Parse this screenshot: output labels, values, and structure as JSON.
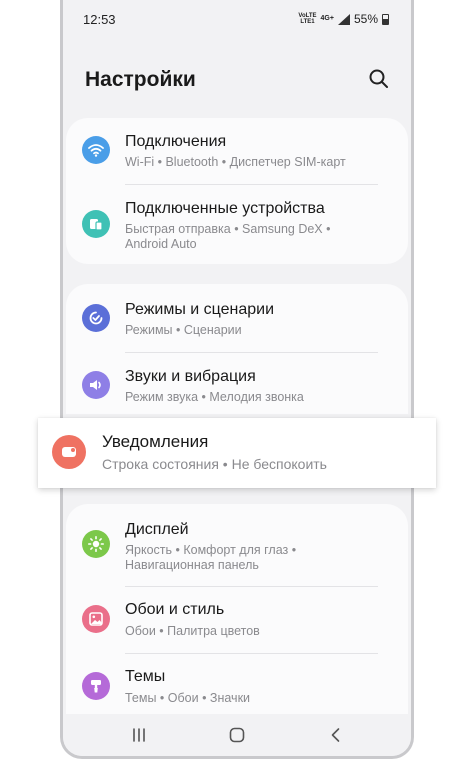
{
  "status_bar": {
    "time": "12:53",
    "network_top": "VoLTE",
    "network_bottom": "LTE1",
    "network_type": "4G+",
    "battery_percent": "55%"
  },
  "header": {
    "title": "Настройки",
    "search_icon": "search-icon"
  },
  "settings": {
    "connections": {
      "title": "Подключения",
      "subtitle": "Wi-Fi  •  Bluetooth  •  Диспетчер SIM-карт",
      "icon": "wifi-icon",
      "color": "#4a9ee8"
    },
    "connected_devices": {
      "title": "Подключенные устройства",
      "subtitle_line1": "Быстрая отправка  •  Samsung DeX  •",
      "subtitle_line2": "Android Auto",
      "icon": "devices-icon",
      "color": "#3fc1b5"
    },
    "modes": {
      "title": "Режимы и сценарии",
      "subtitle": "Режимы  •  Сценарии",
      "icon": "check-circle-icon",
      "color": "#5b6fd8"
    },
    "sounds": {
      "title": "Звуки и вибрация",
      "subtitle": "Режим звука  •  Мелодия звонка",
      "icon": "speaker-icon",
      "color": "#8e7fe6"
    },
    "notifications": {
      "title": "Уведомления",
      "subtitle": "Строка состояния  •  Не беспокоить",
      "icon": "notification-icon",
      "color": "#ef7262"
    },
    "display": {
      "title": "Дисплей",
      "subtitle_line1": "Яркость  •  Комфорт для глаз  •",
      "subtitle_line2": "Навигационная панель",
      "icon": "sun-icon",
      "color": "#7cc84a"
    },
    "wallpaper": {
      "title": "Обои и стиль",
      "subtitle": "Обои  •  Палитра цветов",
      "icon": "image-icon",
      "color": "#ea6f8a"
    },
    "themes": {
      "title": "Темы",
      "subtitle": "Темы  •  Обои  •  Значки",
      "icon": "brush-icon",
      "color": "#b56ad8"
    }
  },
  "navbar": {
    "recents_icon": "recents-icon",
    "home_icon": "home-icon",
    "back_icon": "back-icon"
  }
}
